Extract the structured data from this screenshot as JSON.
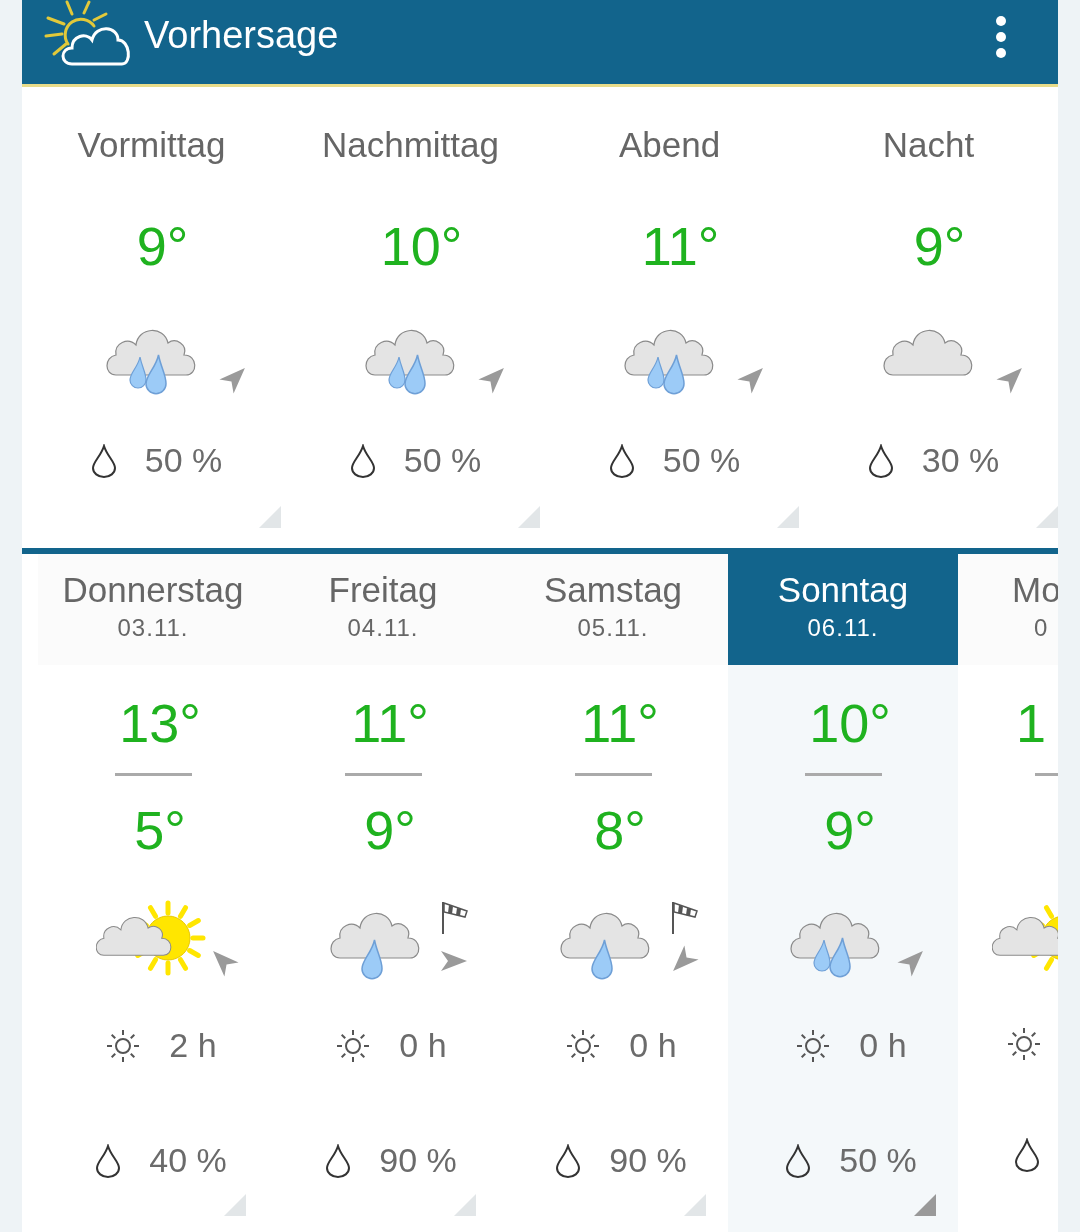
{
  "app_bar": {
    "title": "Vorhersage"
  },
  "periods": [
    {
      "label": "Vormittag",
      "temp": "9°",
      "weather_icon": {
        "kind": "rain"
      },
      "wind_arrow": {
        "kind": "ne"
      },
      "precip": "50 %"
    },
    {
      "label": "Nachmittag",
      "temp": "10°",
      "weather_icon": {
        "kind": "rain"
      },
      "wind_arrow": {
        "kind": "ne"
      },
      "precip": "50 %"
    },
    {
      "label": "Abend",
      "temp": "11°",
      "weather_icon": {
        "kind": "rain"
      },
      "wind_arrow": {
        "kind": "ne"
      },
      "precip": "50 %"
    },
    {
      "label": "Nacht",
      "temp": "9°",
      "weather_icon": {
        "kind": "cloudy"
      },
      "wind_arrow": {
        "kind": "ne"
      },
      "precip": "30 %"
    }
  ],
  "days": [
    {
      "day": "Donnerstag",
      "date": "03.11.",
      "high": "13°",
      "low": "5°",
      "weather_icon": {
        "kind": "partly_sunny"
      },
      "wind_arrow": {
        "kind": "nw"
      },
      "gusts": false,
      "sunshine": "2 h",
      "precip": "40 %",
      "selected": false
    },
    {
      "day": "Freitag",
      "date": "04.11.",
      "high": "11°",
      "low": "9°",
      "weather_icon": {
        "kind": "light_rain"
      },
      "wind_arrow": {
        "kind": "e"
      },
      "gusts": true,
      "sunshine": "0 h",
      "precip": "90 %",
      "selected": false
    },
    {
      "day": "Samstag",
      "date": "05.11.",
      "high": "11°",
      "low": "8°",
      "weather_icon": {
        "kind": "light_rain"
      },
      "wind_arrow": {
        "kind": "sw"
      },
      "gusts": true,
      "sunshine": "0 h",
      "precip": "90 %",
      "selected": false
    },
    {
      "day": "Sonntag",
      "date": "06.11.",
      "high": "10°",
      "low": "9°",
      "weather_icon": {
        "kind": "rain"
      },
      "wind_arrow": {
        "kind": "ne"
      },
      "gusts": false,
      "sunshine": "0 h",
      "precip": "50 %",
      "selected": true
    },
    {
      "day": "Mo",
      "date": "0",
      "high": "1",
      "weather_icon": {
        "kind": "partly_sunny"
      },
      "partial": true,
      "selected": false
    }
  ]
}
